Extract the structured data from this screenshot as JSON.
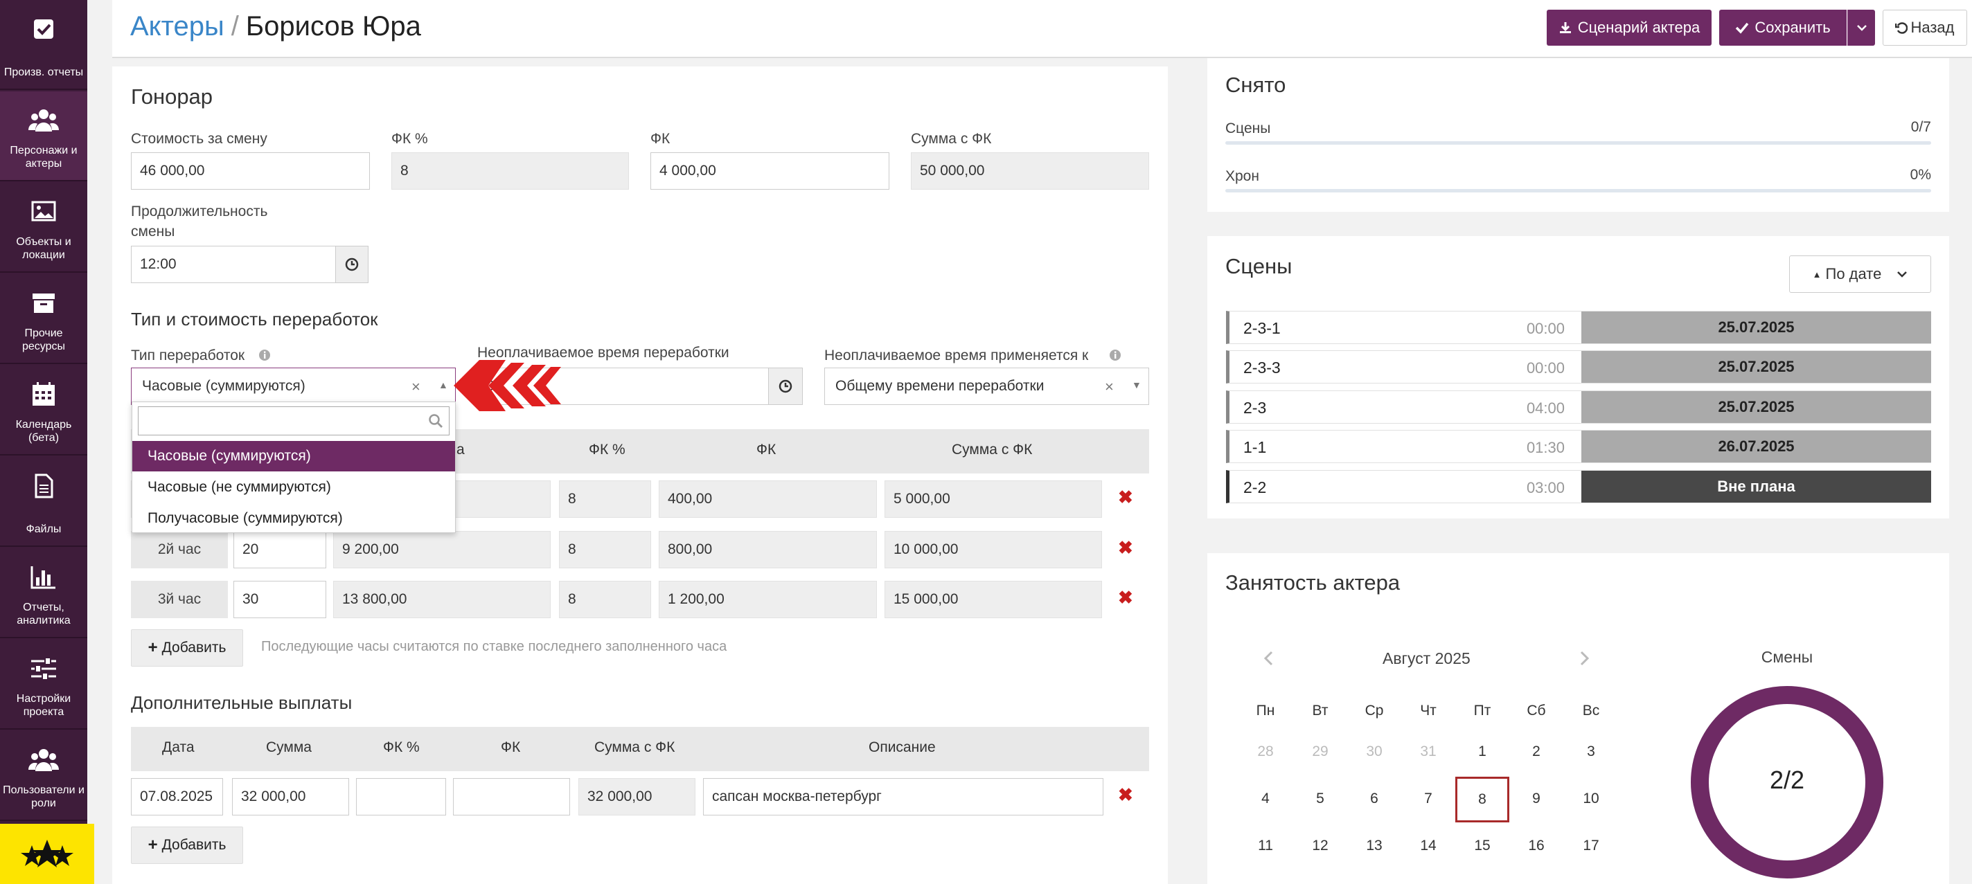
{
  "sidebar": {
    "items": [
      {
        "label": "Произв. отчеты",
        "icon": "check-square-icon"
      },
      {
        "label": "Персонажи и актеры",
        "icon": "users-icon"
      },
      {
        "label": "Объекты и локации",
        "icon": "image-icon"
      },
      {
        "label": "Прочие ресурсы",
        "icon": "archive-icon"
      },
      {
        "label": "Календарь (бета)",
        "icon": "calendar-icon"
      },
      {
        "label": "Файлы",
        "icon": "file-icon"
      },
      {
        "label": "Отчеты, аналитика",
        "icon": "bar-chart-icon"
      },
      {
        "label": "Настройки проекта",
        "icon": "sliders-icon"
      },
      {
        "label": "Пользователи и роли",
        "icon": "users-icon"
      }
    ]
  },
  "header": {
    "breadcrumb_link": "Актеры",
    "separator": "/",
    "title": "Борисов Юра",
    "script_button": "Сценарий актера",
    "save_button": "Сохранить",
    "back_button": "Назад"
  },
  "fee": {
    "title": "Гонорар",
    "shift_cost_label": "Стоимость за смену",
    "shift_cost": "46 000,00",
    "fk_pct_label": "ФК %",
    "fk_pct": "8",
    "fk_label": "ФК",
    "fk": "4 000,00",
    "sum_fk_label": "Сумма с ФК",
    "sum_fk": "50 000,00",
    "duration_label_1": "Продолжительность",
    "duration_label_2": "смены",
    "duration": "12:00"
  },
  "overtime": {
    "title": "Тип и стоимость переработок",
    "type_label": "Тип переработок",
    "type_value": "Часовые (суммируются)",
    "unpaid_label": "Неоплачиваемое время переработки",
    "unpaid_value": "0:",
    "applies_label": "Неоплачиваемое время применяется к",
    "applies_value": "Общему времени переработки",
    "dropdown_options": [
      "Часовые (суммируются)",
      "Часовые (не суммируются)",
      "Получасовые (суммируются)"
    ],
    "columns": [
      "а",
      "ФК %",
      "ФК",
      "Сумма с ФК"
    ],
    "rows": [
      {
        "hour": "",
        "pct": "",
        "sum": "",
        "fk_pct": "8",
        "fk": "400,00",
        "total": "5 000,00"
      },
      {
        "hour": "2й час",
        "pct": "20",
        "sum": "9 200,00",
        "fk_pct": "8",
        "fk": "800,00",
        "total": "10 000,00"
      },
      {
        "hour": "3й час",
        "pct": "30",
        "sum": "13 800,00",
        "fk_pct": "8",
        "fk": "1 200,00",
        "total": "15 000,00"
      }
    ],
    "add_label": "Добавить",
    "hint": "Последующие часы считаются по ставке последнего заполненного часа"
  },
  "extra": {
    "title": "Дополнительные выплаты",
    "columns": [
      "Дата",
      "Сумма",
      "ФК %",
      "ФК",
      "Сумма с ФК",
      "Описание"
    ],
    "row": {
      "date": "07.08.2025",
      "sum": "32 000,00",
      "fk_pct": "",
      "fk": "",
      "total": "32 000,00",
      "desc": "сапсан москва-петербург"
    },
    "add_label": "Добавить"
  },
  "filmed": {
    "title": "Снято",
    "scenes_label": "Сцены",
    "scenes_value": "0/7",
    "scenes_progress": 0,
    "chron_label": "Хрон",
    "chron_value": "0%",
    "chron_progress": 0
  },
  "scenes": {
    "title": "Сцены",
    "sort_label": "По дате",
    "items": [
      {
        "name": "2-3-1",
        "time": "00:00",
        "date": "25.07.2025"
      },
      {
        "name": "2-3-3",
        "time": "00:00",
        "date": "25.07.2025"
      },
      {
        "name": "2-3",
        "time": "04:00",
        "date": "25.07.2025"
      },
      {
        "name": "1-1",
        "time": "01:30",
        "date": "26.07.2025"
      },
      {
        "name": "2-2",
        "time": "03:00",
        "date": "Вне плана"
      }
    ]
  },
  "busy": {
    "title": "Занятость актера",
    "month": "Август 2025",
    "weekdays": [
      "Пн",
      "Вт",
      "Ср",
      "Чт",
      "Пт",
      "Сб",
      "Вс"
    ],
    "week1": [
      "28",
      "29",
      "30",
      "31",
      "1",
      "2",
      "3"
    ],
    "week2": [
      "4",
      "5",
      "6",
      "7",
      "8",
      "9",
      "10"
    ],
    "week3": [
      "11",
      "12",
      "13",
      "14",
      "15",
      "16",
      "17"
    ],
    "selected_day": "8",
    "shifts_label": "Смены",
    "shifts_value": "2/2",
    "shifts_fraction": 1.0,
    "accent": "#6e2a64"
  }
}
